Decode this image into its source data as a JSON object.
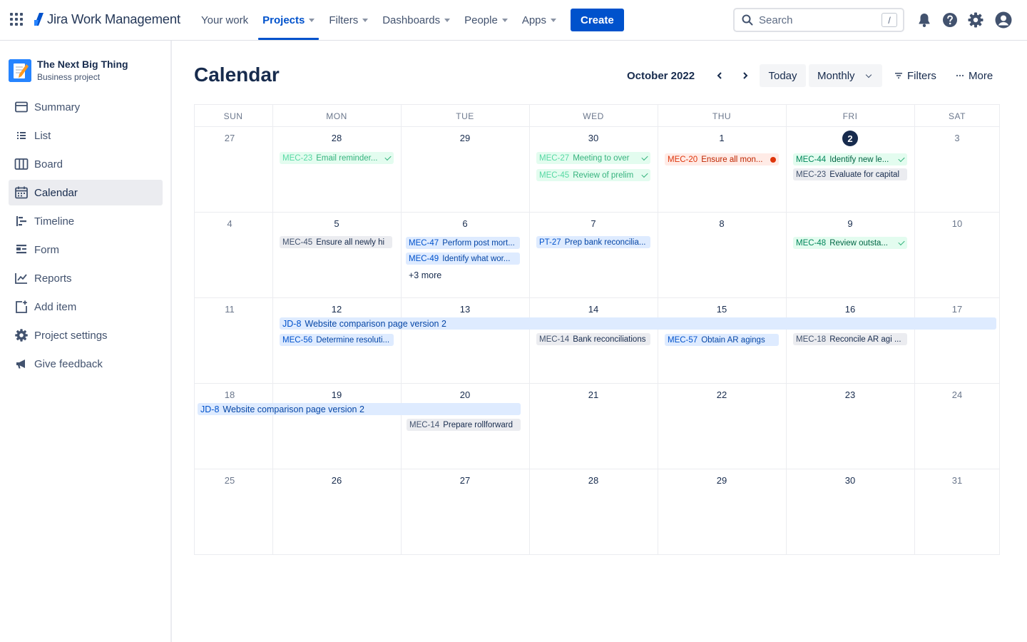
{
  "topnav": {
    "brand": "Jira Work Management",
    "links": [
      {
        "label": "Your work"
      },
      {
        "label": "Projects"
      },
      {
        "label": "Filters"
      },
      {
        "label": "Dashboards"
      },
      {
        "label": "People"
      },
      {
        "label": "Apps"
      }
    ],
    "create_label": "Create",
    "search": {
      "placeholder": "Search",
      "shortcut": "/"
    },
    "icons": [
      "bell-icon",
      "help-icon",
      "settings-icon",
      "profile-icon"
    ]
  },
  "sidebar": {
    "project_name": "The Next Big Thing",
    "project_type": "Business project",
    "items": [
      {
        "label": "Summary"
      },
      {
        "label": "List"
      },
      {
        "label": "Board"
      },
      {
        "label": "Calendar"
      },
      {
        "label": "Timeline"
      },
      {
        "label": "Form"
      },
      {
        "label": "Reports"
      },
      {
        "label": "Add item"
      },
      {
        "label": "Project settings"
      },
      {
        "label": "Give feedback"
      }
    ]
  },
  "calendar": {
    "title": "Calendar",
    "month": "October 2022",
    "today_label": "Today",
    "view_label": "Monthly",
    "filters_label": "Filters",
    "more_label": "More",
    "weekdays": [
      "SUN",
      "MON",
      "TUE",
      "WED",
      "THU",
      "FRI",
      "SAT"
    ],
    "weeks": [
      [
        "27",
        "28",
        "29",
        "30",
        "1",
        "2",
        "3"
      ],
      [
        "4",
        "5",
        "6",
        "7",
        "8",
        "9",
        "10"
      ],
      [
        "11",
        "12",
        "13",
        "14",
        "15",
        "16",
        "17"
      ],
      [
        "18",
        "19",
        "20",
        "21",
        "22",
        "23",
        "24"
      ],
      [
        "25",
        "26",
        "27",
        "28",
        "29",
        "30",
        "31"
      ]
    ],
    "today": "2",
    "events": {
      "w0": [
        {
          "key": "MEC-23",
          "summary": "Email reminder...",
          "status": "done"
        },
        {
          "key": "MEC-27",
          "summary": "Meeting to over",
          "status": "done"
        },
        {
          "key": "MEC-45",
          "summary": "Review of prelim",
          "status": "done"
        },
        {
          "key": "MEC-20",
          "summary": "Ensure all mon...",
          "status": "overdue"
        },
        {
          "key": "MEC-44",
          "summary": "Identify new le...",
          "status": "done"
        },
        {
          "key": "MEC-23",
          "summary": "Evaluate for capital",
          "status": "todo"
        }
      ],
      "w1": [
        {
          "key": "MEC-45",
          "summary": "Ensure all newly hi",
          "status": "todo"
        },
        {
          "key": "MEC-47",
          "summary": "Perform post mort...",
          "status": "in-progress"
        },
        {
          "key": "MEC-49",
          "summary": "Identify what wor...",
          "status": "in-progress"
        },
        {
          "key": "PT-27",
          "summary": "Prep bank reconcilia...",
          "status": "in-progress"
        },
        {
          "key": "MEC-48",
          "summary": "Review outsta...",
          "status": "done"
        }
      ],
      "w1_more": "+3 more",
      "w2": [
        {
          "key": "JD-8",
          "summary": "Website comparison page version 2",
          "status": "in-progress"
        },
        {
          "key": "MEC-56",
          "summary": "Determine resoluti...",
          "status": "in-progress"
        },
        {
          "key": "MEC-14",
          "summary": "Bank reconciliations",
          "status": "todo"
        },
        {
          "key": "MEC-57",
          "summary": "Obtain AR agings",
          "status": "in-progress"
        },
        {
          "key": "MEC-18",
          "summary": "Reconcile AR agi ...",
          "status": "todo"
        }
      ],
      "w3": [
        {
          "key": "JD-8",
          "summary": "Website comparison page version 2",
          "status": "in-progress"
        },
        {
          "key": "MEC-14",
          "summary": "Prepare rollforward",
          "status": "todo"
        }
      ]
    }
  },
  "colors": {
    "primary": "#0052cc",
    "text": "#172b4d",
    "subtle": "#42526e",
    "done_bg": "#e3fcef",
    "in_progress_bg": "#deebff",
    "todo_bg": "#ebecf0",
    "overdue_bg": "#ffebe6"
  }
}
